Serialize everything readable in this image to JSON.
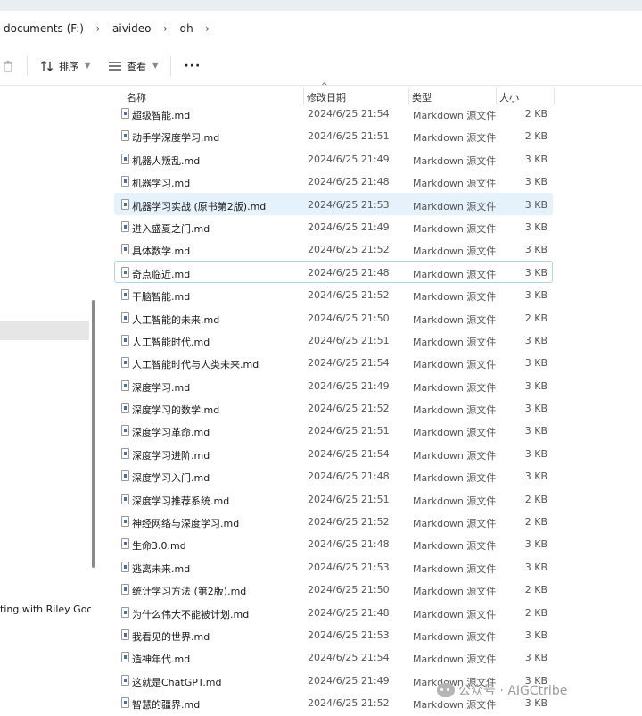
{
  "breadcrumb": {
    "items": [
      "documents (F:)",
      "aivideo",
      "dh"
    ],
    "separator": "›"
  },
  "toolbar": {
    "sort_label": "排序",
    "view_label": "查看",
    "more_label": "···"
  },
  "nav": {
    "partial_item": "ting with Riley Goodsi"
  },
  "columns": {
    "name": "名称",
    "date": "修改日期",
    "type": "类型",
    "size": "大小"
  },
  "files": [
    {
      "name": "超级智能.md",
      "date": "2024/6/25 21:54",
      "type": "Markdown 源文件",
      "size": "2 KB"
    },
    {
      "name": "动手学深度学习.md",
      "date": "2024/6/25 21:51",
      "type": "Markdown 源文件",
      "size": "2 KB"
    },
    {
      "name": "机器人叛乱.md",
      "date": "2024/6/25 21:49",
      "type": "Markdown 源文件",
      "size": "3 KB"
    },
    {
      "name": "机器学习.md",
      "date": "2024/6/25 21:48",
      "type": "Markdown 源文件",
      "size": "3 KB"
    },
    {
      "name": "机器学习实战 (原书第2版).md",
      "date": "2024/6/25 21:53",
      "type": "Markdown 源文件",
      "size": "3 KB"
    },
    {
      "name": "进入盛夏之门.md",
      "date": "2024/6/25 21:49",
      "type": "Markdown 源文件",
      "size": "3 KB"
    },
    {
      "name": "具体数学.md",
      "date": "2024/6/25 21:52",
      "type": "Markdown 源文件",
      "size": "3 KB"
    },
    {
      "name": "奇点临近.md",
      "date": "2024/6/25 21:48",
      "type": "Markdown 源文件",
      "size": "3 KB"
    },
    {
      "name": "干脑智能.md",
      "date": "2024/6/25 21:52",
      "type": "Markdown 源文件",
      "size": "3 KB"
    },
    {
      "name": "人工智能的未来.md",
      "date": "2024/6/25 21:50",
      "type": "Markdown 源文件",
      "size": "2 KB"
    },
    {
      "name": "人工智能时代.md",
      "date": "2024/6/25 21:51",
      "type": "Markdown 源文件",
      "size": "3 KB"
    },
    {
      "name": "人工智能时代与人类未来.md",
      "date": "2024/6/25 21:54",
      "type": "Markdown 源文件",
      "size": "3 KB"
    },
    {
      "name": "深度学习.md",
      "date": "2024/6/25 21:49",
      "type": "Markdown 源文件",
      "size": "3 KB"
    },
    {
      "name": "深度学习的数学.md",
      "date": "2024/6/25 21:52",
      "type": "Markdown 源文件",
      "size": "3 KB"
    },
    {
      "name": "深度学习革命.md",
      "date": "2024/6/25 21:51",
      "type": "Markdown 源文件",
      "size": "3 KB"
    },
    {
      "name": "深度学习进阶.md",
      "date": "2024/6/25 21:54",
      "type": "Markdown 源文件",
      "size": "3 KB"
    },
    {
      "name": "深度学习入门.md",
      "date": "2024/6/25 21:48",
      "type": "Markdown 源文件",
      "size": "3 KB"
    },
    {
      "name": "深度学习推荐系统.md",
      "date": "2024/6/25 21:51",
      "type": "Markdown 源文件",
      "size": "2 KB"
    },
    {
      "name": "神经网络与深度学习.md",
      "date": "2024/6/25 21:52",
      "type": "Markdown 源文件",
      "size": "2 KB"
    },
    {
      "name": "生命3.0.md",
      "date": "2024/6/25 21:48",
      "type": "Markdown 源文件",
      "size": "3 KB"
    },
    {
      "name": "逃离未来.md",
      "date": "2024/6/25 21:53",
      "type": "Markdown 源文件",
      "size": "3 KB"
    },
    {
      "name": "统计学习方法 (第2版).md",
      "date": "2024/6/25 21:50",
      "type": "Markdown 源文件",
      "size": "2 KB"
    },
    {
      "name": "为什么伟大不能被计划.md",
      "date": "2024/6/25 21:48",
      "type": "Markdown 源文件",
      "size": "2 KB"
    },
    {
      "name": "我看见的世界.md",
      "date": "2024/6/25 21:53",
      "type": "Markdown 源文件",
      "size": "3 KB"
    },
    {
      "name": "造神年代.md",
      "date": "2024/6/25 21:54",
      "type": "Markdown 源文件",
      "size": "3 KB"
    },
    {
      "name": "这就是ChatGPT.md",
      "date": "2024/6/25 21:49",
      "type": "Markdown 源文件",
      "size": "3 KB"
    },
    {
      "name": "智慧的疆界.md",
      "date": "2024/6/25 21:52",
      "type": "Markdown 源文件",
      "size": "3 KB"
    }
  ],
  "watermark": {
    "text": "公众号 · AIGCtribe"
  }
}
